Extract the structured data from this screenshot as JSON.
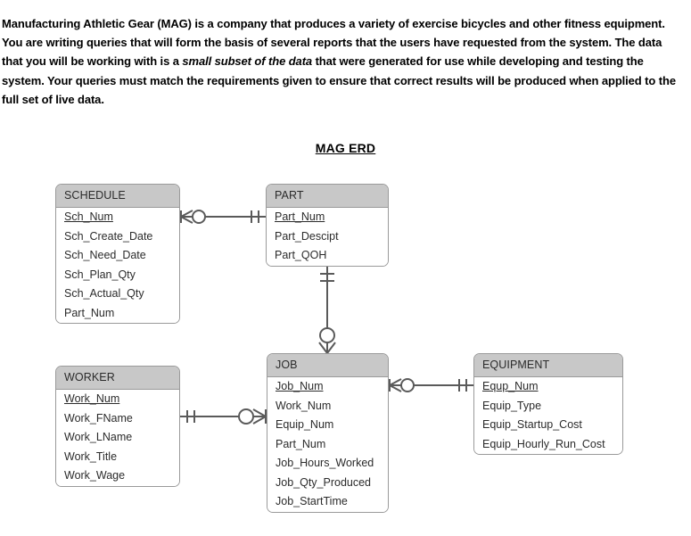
{
  "intro": {
    "segments": [
      {
        "text": "Manufacturing Athletic Gear (MAG) is a company that produces a variety of exercise bicycles and other fitness equipment.  You are writing queries that will form the basis of several reports that the users have requested from the system.  The data that you will be working with is a ",
        "style": "normal"
      },
      {
        "text": "small subset of the data",
        "style": "italic"
      },
      {
        "text": " that were generated for use while developing and testing the system.  Your queries must match the requirements given to ensure that correct results will be produced when applied to the full set of live data.",
        "style": "normal"
      }
    ]
  },
  "diagram": {
    "title": "MAG ERD",
    "entities": [
      {
        "name": "SCHEDULE",
        "attributes": [
          {
            "name": "Sch_Num",
            "key": "pk"
          },
          {
            "name": "Sch_Create_Date",
            "key": ""
          },
          {
            "name": "Sch_Need_Date",
            "key": ""
          },
          {
            "name": "Sch_Plan_Qty",
            "key": ""
          },
          {
            "name": "Sch_Actual_Qty",
            "key": ""
          },
          {
            "name": "Part_Num",
            "key": "fk"
          }
        ]
      },
      {
        "name": "PART",
        "attributes": [
          {
            "name": "Part_Num",
            "key": "pk"
          },
          {
            "name": "Part_Descipt",
            "key": ""
          },
          {
            "name": "Part_QOH",
            "key": ""
          }
        ]
      },
      {
        "name": "WORKER",
        "attributes": [
          {
            "name": "Work_Num",
            "key": "pk"
          },
          {
            "name": "Work_FName",
            "key": ""
          },
          {
            "name": "Work_LName",
            "key": ""
          },
          {
            "name": "Work_Title",
            "key": ""
          },
          {
            "name": "Work_Wage",
            "key": ""
          }
        ]
      },
      {
        "name": "JOB",
        "attributes": [
          {
            "name": "Job_Num",
            "key": "pk"
          },
          {
            "name": "Work_Num",
            "key": "fk"
          },
          {
            "name": "Equip_Num",
            "key": "fk"
          },
          {
            "name": "Part_Num",
            "key": "fk"
          },
          {
            "name": "Job_Hours_Worked",
            "key": ""
          },
          {
            "name": "Job_Qty_Produced",
            "key": ""
          },
          {
            "name": "Job_StartTime",
            "key": ""
          }
        ]
      },
      {
        "name": "EQUIPMENT",
        "attributes": [
          {
            "name": "Equp_Num",
            "key": "pk"
          },
          {
            "name": "Equip_Type",
            "key": ""
          },
          {
            "name": "Equip_Startup_Cost",
            "key": ""
          },
          {
            "name": "Equip_Hourly_Run_Cost",
            "key": ""
          }
        ]
      }
    ],
    "relationships": [
      {
        "from": "SCHEDULE",
        "to": "PART",
        "from_cardinality": "zero-or-many",
        "to_cardinality": "one-and-only-one"
      },
      {
        "from": "PART",
        "to": "JOB",
        "from_cardinality": "one-and-only-one",
        "to_cardinality": "zero-or-many"
      },
      {
        "from": "WORKER",
        "to": "JOB",
        "from_cardinality": "one-and-only-one",
        "to_cardinality": "zero-or-many"
      },
      {
        "from": "JOB",
        "to": "EQUIPMENT",
        "from_cardinality": "zero-or-many",
        "to_cardinality": "one-and-only-one"
      }
    ],
    "colors": {
      "header_fill": "#c8c8c8",
      "border": "#9a9a9a",
      "body_fill": "#ffffff",
      "connector": "#5a5a5a",
      "text": "#2b2b2b"
    }
  }
}
